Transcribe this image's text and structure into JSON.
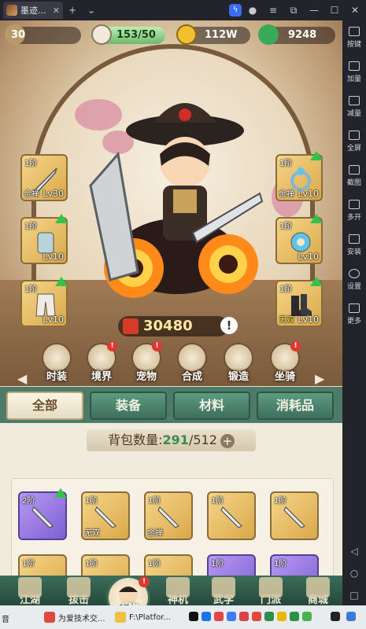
{
  "window": {
    "tab_title": "墨迹...",
    "tab_close": "✕",
    "new_tab": "+",
    "dropdown": "⌄",
    "controls": [
      "≡",
      "⧉",
      "—",
      "☐",
      "✕"
    ]
  },
  "sidebar": {
    "items": [
      {
        "label": "按键",
        "icon": "keyboard-icon"
      },
      {
        "label": "加量",
        "icon": "volume-up-icon"
      },
      {
        "label": "减量",
        "icon": "volume-down-icon"
      },
      {
        "label": "全屏",
        "icon": "fullscreen-icon"
      },
      {
        "label": "截图",
        "icon": "screenshot-icon"
      },
      {
        "label": "多开",
        "icon": "multi-instance-icon"
      },
      {
        "label": "安装",
        "icon": "install-icon"
      },
      {
        "label": "设置",
        "icon": "settings-icon"
      },
      {
        "label": "更多",
        "icon": "more-icon"
      }
    ],
    "nav": [
      "◁",
      "○",
      "□"
    ]
  },
  "top_stats": {
    "level": "30",
    "stamina": "153/50",
    "coins": "112W",
    "jade": "9248"
  },
  "equipment_left": [
    {
      "tier": "1阶",
      "rank": "金禅",
      "level": "Lv30",
      "upgrade": false,
      "icon": "sword-icon"
    },
    {
      "tier": "1阶",
      "rank": "",
      "level": "Lv10",
      "upgrade": true,
      "icon": "armor-icon"
    },
    {
      "tier": "1阶",
      "rank": "",
      "level": "Lv10",
      "upgrade": true,
      "icon": "pants-icon"
    }
  ],
  "equipment_right": [
    {
      "tier": "1阶",
      "rank": "金禅",
      "level": "Lv10",
      "upgrade": true,
      "icon": "ring-icon"
    },
    {
      "tier": "1阶",
      "rank": "",
      "level": "Lv10",
      "upgrade": true,
      "icon": "amulet-icon"
    },
    {
      "tier": "1阶",
      "rank": "无双",
      "level": "Lv10",
      "upgrade": true,
      "icon": "boots-icon"
    }
  ],
  "power": {
    "value": "30480",
    "info": "!"
  },
  "functions": [
    {
      "label": "时装",
      "alert": false
    },
    {
      "label": "境界",
      "alert": true
    },
    {
      "label": "宠物",
      "alert": true
    },
    {
      "label": "合成",
      "alert": false
    },
    {
      "label": "锻造",
      "alert": false
    },
    {
      "label": "坐骑",
      "alert": true
    }
  ],
  "nav_arrows": {
    "left": "◀",
    "right": "▶"
  },
  "category_tabs": [
    "全部",
    "装备",
    "材料",
    "消耗品"
  ],
  "bag": {
    "label": "背包数量:",
    "current": "291",
    "max": "/512",
    "plus": "+",
    "items": [
      {
        "tier": "2阶",
        "rank": "",
        "color": "purple",
        "upgrade": true
      },
      {
        "tier": "1阶",
        "rank": "无双",
        "color": "gold",
        "upgrade": false
      },
      {
        "tier": "1阶",
        "rank": "金禅",
        "color": "gold",
        "upgrade": false
      },
      {
        "tier": "1阶",
        "rank": "",
        "color": "gold",
        "upgrade": false
      },
      {
        "tier": "1阶",
        "rank": "",
        "color": "gold",
        "upgrade": false
      },
      {
        "tier": "1阶",
        "rank": "",
        "color": "gold",
        "upgrade": false
      },
      {
        "tier": "1阶",
        "rank": "",
        "color": "gold",
        "upgrade": false
      },
      {
        "tier": "1阶",
        "rank": "",
        "color": "gold",
        "upgrade": false
      },
      {
        "tier": "1阶",
        "rank": "",
        "color": "purple",
        "upgrade": false
      },
      {
        "tier": "1阶",
        "rank": "",
        "color": "purple",
        "upgrade": false
      }
    ]
  },
  "bottom_nav": [
    {
      "label": "江湖",
      "alert": false
    },
    {
      "label": "拔击",
      "alert": false
    },
    {
      "label": "人物",
      "alert": true
    },
    {
      "label": "神机",
      "alert": false
    },
    {
      "label": "武学",
      "alert": true
    },
    {
      "label": "门派",
      "alert": false
    },
    {
      "label": "商城",
      "alert": false
    }
  ],
  "taskbar": {
    "left_text": "音",
    "items": [
      {
        "label": "为爱技术交...",
        "color": "#e0483c"
      },
      {
        "label": "F:\\Platfor...",
        "color": "#f0c040"
      }
    ],
    "tray_colors": [
      "#111111",
      "#1a73e8",
      "#e04848",
      "#3d7eff",
      "#d8434a",
      "#e0483c",
      "#2a8f4a",
      "#e9b800",
      "#2a8f4a",
      "#4caf50",
      "#222222",
      "#3a7bd5"
    ]
  }
}
